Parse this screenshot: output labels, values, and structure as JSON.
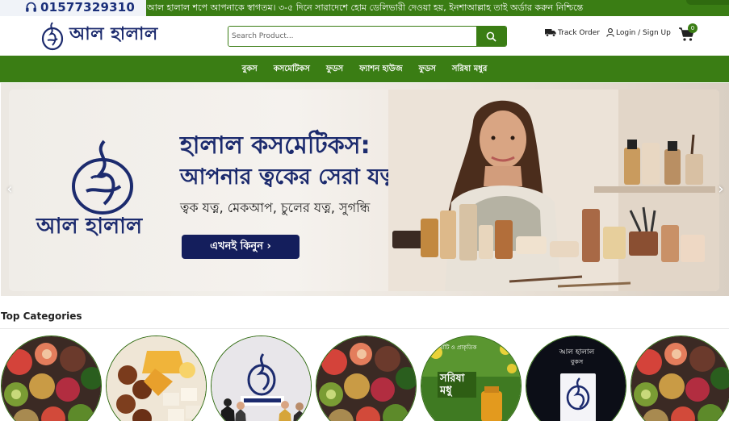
{
  "topbar": {
    "phone": "01577329310",
    "phone_icon": "headset-icon",
    "announcement": "আল হালাল শপে আপনাকে স্বাগতম। ৩-৫ দিনে সারাদেশে হোম ডেলিভারী দেওয়া হয়, ইনশাআল্লাহ তাই অর্ডার করুন নিশ্চিন্তে",
    "bg_color": "#3a7d14",
    "phone_color": "#1a2f7a"
  },
  "header": {
    "logo_text": "আল হালাল",
    "search_placeholder": "Search Product...",
    "search_icon": "search-icon",
    "track_label": "Track Order",
    "track_icon": "truck-icon",
    "login_label": "Login / Sign Up",
    "login_icon": "user-icon",
    "cart_icon": "cart-icon",
    "cart_count": "0",
    "brand_color": "#1c2b6e"
  },
  "nav": {
    "items": [
      {
        "label": "বুকস"
      },
      {
        "label": "কসমেটিকস"
      },
      {
        "label": "ফুডস"
      },
      {
        "label": "ফ্যাশন হাউজ"
      },
      {
        "label": "ফুডস"
      },
      {
        "label": "সরিষা মধুর"
      }
    ]
  },
  "hero": {
    "brand": "আল হালাল",
    "title_line1": "হালাল কসমেটিকস:",
    "title_line2": "আপনার ত্বকের সেরা যত্ন",
    "subtitle": "ত্বক যত্ন, মেকআপ, চুলের যত্ন, সুগন্ধি",
    "cta": "এখনই কিনুন ›",
    "prev_icon": "chevron-left-icon",
    "next_icon": "chevron-right-icon",
    "cta_color": "#141e5c"
  },
  "categories": {
    "title": "Top Categories",
    "items": [
      {
        "icon": "food-bowls-image"
      },
      {
        "icon": "sweets-image"
      },
      {
        "icon": "brand-fashion-image"
      },
      {
        "icon": "food-bowls-image"
      },
      {
        "icon": "mustard-honey-image",
        "title": "সরিষা মধু",
        "caption": "খাঁটি ও প্রাকৃতিক"
      },
      {
        "icon": "books-image",
        "title": "আল হালাল",
        "caption": "বুকস"
      },
      {
        "icon": "food-bowls-image"
      }
    ]
  }
}
